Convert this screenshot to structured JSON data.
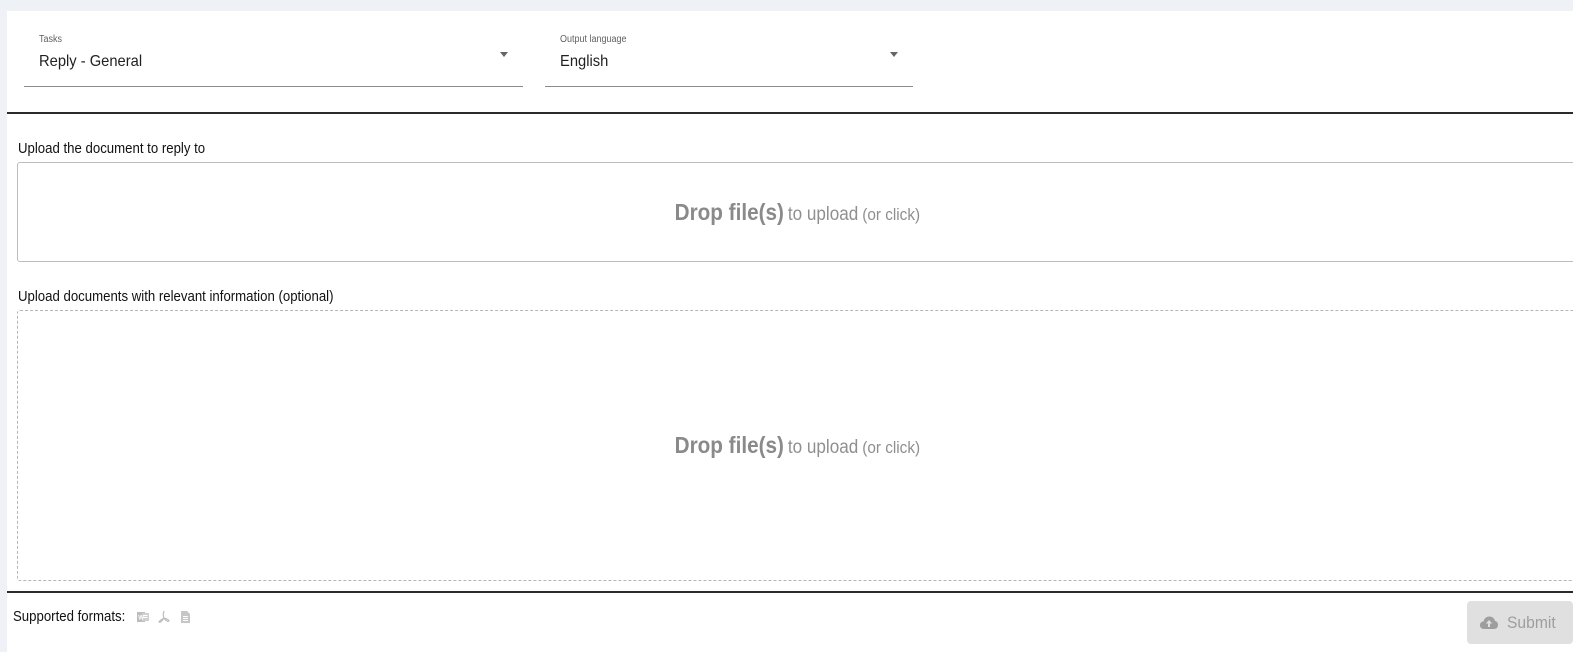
{
  "form": {
    "tasks": {
      "label": "Tasks",
      "value": "Reply - General"
    },
    "output_language": {
      "label": "Output language",
      "value": "English"
    }
  },
  "upload_reply": {
    "label": "Upload the document to reply to",
    "drop_strong": "Drop file(s)",
    "drop_mid": "to upload",
    "drop_small": "(or click)"
  },
  "upload_relevant": {
    "label": "Upload documents with relevant information (optional)",
    "drop_strong": "Drop file(s)",
    "drop_mid": "to upload",
    "drop_small": "(or click)"
  },
  "footer": {
    "supported_formats_label": "Supported formats:",
    "format_icons": [
      "word-document-icon",
      "pdf-icon",
      "text-file-icon"
    ],
    "submit_label": "Submit",
    "submit_icon": "cloud-upload-icon",
    "submit_enabled": false
  }
}
